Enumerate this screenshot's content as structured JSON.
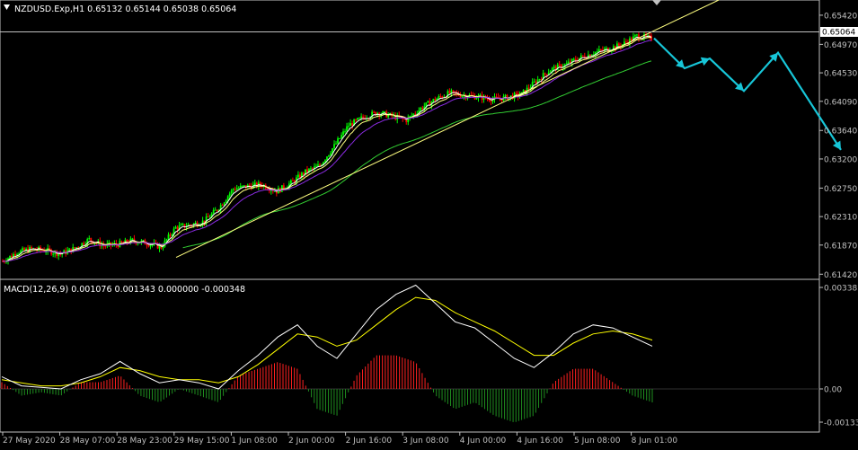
{
  "main_header": {
    "symbol": "NZDUSD.Exp,H1",
    "ohlc": "0.65132 0.65144 0.65038 0.65064",
    "current_price_label": "0.65064"
  },
  "macd_header": {
    "indicator": "MACD(12,26,9)",
    "values": "0.001076 0.001343 0.000000 -0.000348"
  },
  "colors": {
    "background": "#000000",
    "axis": "#c0c0c0",
    "bull": "#00ff00",
    "bear": "#ff0000",
    "ma_fast": "#ffffff",
    "ma_slow": "#ffff80",
    "ma_mid": "#8a2be2",
    "ma_long": "#32cd32",
    "trendline": "#ffff80",
    "forecast_arrow": "#17c6d8",
    "macd_line": "#ffffff",
    "signal_line": "#ffff00",
    "hist_pos": "#ff2020",
    "hist_neg": "#1f8f1f"
  },
  "chart_data": [
    {
      "type": "candlestick",
      "title": "NZDUSD.Exp,H1",
      "y_axis_ticks": [
        "0.65420",
        "0.64970",
        "0.64530",
        "0.64090",
        "0.63640",
        "0.63200",
        "0.62750",
        "0.62310",
        "0.61870",
        "0.61420"
      ],
      "ylim": [
        0.6141,
        0.6553
      ],
      "x_axis_ticks": [
        "27 May 2020",
        "28 May 07:00",
        "28 May 23:00",
        "29 May 15:00",
        "1 Jun 08:00",
        "2 Jun 00:00",
        "2 Jun 16:00",
        "3 Jun 08:00",
        "4 Jun 00:00",
        "4 Jun 16:00",
        "5 Jun 08:00",
        "8 Jun 01:00"
      ],
      "close_path": [
        [
          0,
          0.6162
        ],
        [
          8,
          0.6176
        ],
        [
          16,
          0.6181
        ],
        [
          24,
          0.6179
        ],
        [
          32,
          0.6173
        ],
        [
          40,
          0.6182
        ],
        [
          48,
          0.6196
        ],
        [
          56,
          0.6186
        ],
        [
          64,
          0.6188
        ],
        [
          72,
          0.6194
        ],
        [
          80,
          0.619
        ],
        [
          88,
          0.6184
        ],
        [
          96,
          0.6214
        ],
        [
          104,
          0.6218
        ],
        [
          112,
          0.6224
        ],
        [
          120,
          0.6245
        ],
        [
          128,
          0.6274
        ],
        [
          136,
          0.6278
        ],
        [
          144,
          0.628
        ],
        [
          152,
          0.627
        ],
        [
          160,
          0.6283
        ],
        [
          168,
          0.63
        ],
        [
          176,
          0.631
        ],
        [
          184,
          0.634
        ],
        [
          192,
          0.6372
        ],
        [
          200,
          0.6384
        ],
        [
          208,
          0.6392
        ],
        [
          216,
          0.6386
        ],
        [
          224,
          0.638
        ],
        [
          232,
          0.6398
        ],
        [
          240,
          0.6412
        ],
        [
          248,
          0.6422
        ],
        [
          256,
          0.6418
        ],
        [
          264,
          0.6416
        ],
        [
          272,
          0.6412
        ],
        [
          280,
          0.6415
        ],
        [
          288,
          0.642
        ],
        [
          296,
          0.644
        ],
        [
          304,
          0.6458
        ],
        [
          312,
          0.6465
        ],
        [
          320,
          0.6476
        ],
        [
          328,
          0.6484
        ],
        [
          336,
          0.649
        ],
        [
          344,
          0.6497
        ],
        [
          352,
          0.651
        ],
        [
          360,
          0.6506
        ]
      ],
      "price_annotations": {
        "current_price": 0.65064,
        "trendline_start": [
          0.6168,
          "29 May 15:00"
        ],
        "forecast_path": [
          0.65064,
          0.646,
          0.6475,
          0.6425,
          0.6484,
          0.6334
        ]
      }
    },
    {
      "type": "line",
      "title": "MACD(12,26,9)",
      "series_names": [
        "MACD",
        "Signal"
      ],
      "y_axis_ticks": [
        "0.003385",
        "0.00",
        "-0.001335"
      ],
      "ylim": [
        -0.001335,
        0.003385
      ],
      "macd": [
        0.0004,
        0.0001,
        5e-05,
        0.0,
        0.0003,
        0.0005,
        0.0009,
        0.0005,
        0.0002,
        0.0003,
        0.0002,
        0.0,
        0.0006,
        0.0011,
        0.0017,
        0.0021,
        0.0014,
        0.001,
        0.0018,
        0.0026,
        0.0031,
        0.0034,
        0.0028,
        0.0022,
        0.002,
        0.0015,
        0.001,
        0.0007,
        0.0012,
        0.0018,
        0.0021,
        0.002,
        0.0017,
        0.0014
      ],
      "signal": [
        0.0003,
        0.0002,
        0.0001,
        0.0001,
        0.0002,
        0.0004,
        0.0007,
        0.0006,
        0.0004,
        0.0003,
        0.0003,
        0.0002,
        0.0004,
        0.0008,
        0.0013,
        0.0018,
        0.0017,
        0.0014,
        0.0016,
        0.0021,
        0.0026,
        0.003,
        0.0029,
        0.0025,
        0.0022,
        0.0019,
        0.0015,
        0.0011,
        0.0011,
        0.0015,
        0.0018,
        0.0019,
        0.0018,
        0.0016
      ]
    }
  ]
}
